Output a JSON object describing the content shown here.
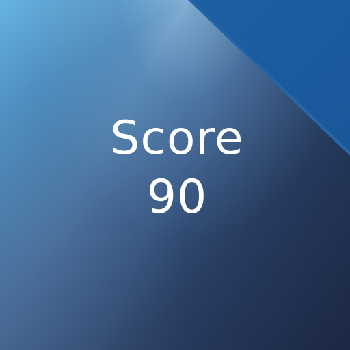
{
  "score": {
    "label": "Score",
    "value": "90"
  },
  "colors": {
    "background_light": "#5fb0df",
    "background_dark": "#22314f",
    "corner_triangle": "#1e63a8",
    "text": "#ffffff"
  }
}
